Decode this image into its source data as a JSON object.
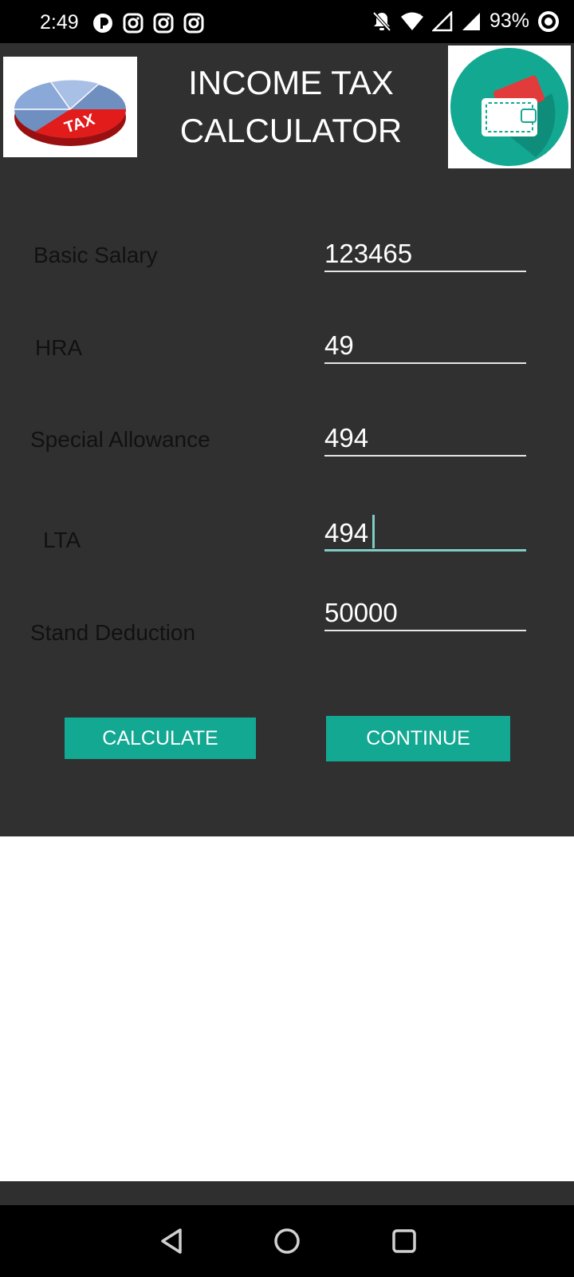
{
  "status_bar": {
    "time": "2:49",
    "battery_percent": "93%",
    "left_icons": [
      "notification-app-icon",
      "instagram-icon",
      "instagram-icon",
      "instagram-icon"
    ],
    "right_icons": [
      "bell-off-icon",
      "wifi-icon",
      "signal-x-icon",
      "signal-icon",
      "battery-ring-icon"
    ]
  },
  "header": {
    "title_line1": "INCOME TAX",
    "title_line2": "CALCULATOR",
    "left_logo_text": "TAX"
  },
  "form": {
    "fields": [
      {
        "label": "Basic Salary",
        "value": "123465"
      },
      {
        "label": "HRA",
        "value": "49"
      },
      {
        "label": "Special Allowance",
        "value": "494"
      },
      {
        "label": "LTA",
        "value": "494"
      },
      {
        "label": "Stand Deduction",
        "value": "50000"
      }
    ],
    "focused_field": "LTA"
  },
  "buttons": {
    "calculate": "CALCULATE",
    "continue": "CONTINUE"
  },
  "colors": {
    "app_background": "#303030",
    "accent": "#13a892",
    "focus_underline": "#7fcdc4",
    "status_bar": "#000000"
  }
}
